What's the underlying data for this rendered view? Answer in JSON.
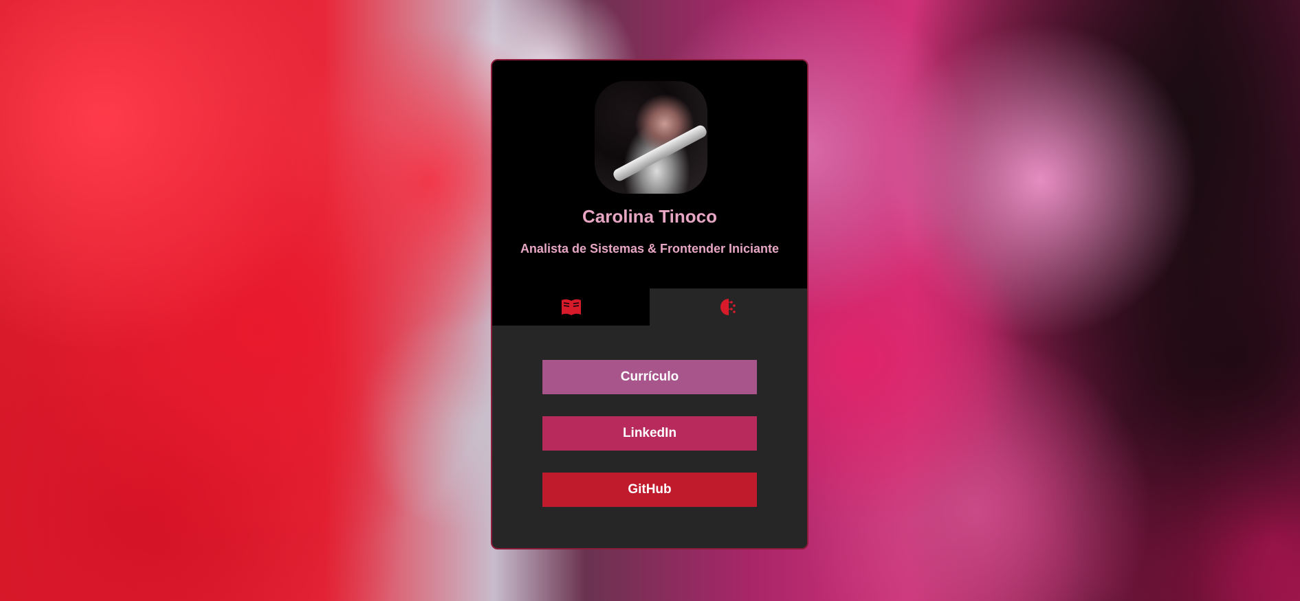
{
  "profile": {
    "name": "Carolina Tinoco",
    "role": "Analista de Sistemas & Frontender Iniciante"
  },
  "tabs": [
    {
      "icon": "book-icon"
    },
    {
      "icon": "brain-icon"
    }
  ],
  "links": [
    {
      "label": "Currículo",
      "color": "#a8558c"
    },
    {
      "label": "LinkedIn",
      "color": "#b92a5c"
    },
    {
      "label": "GitHub",
      "color": "#c01b2c"
    }
  ],
  "colors": {
    "accent": "#e7a7c4",
    "icon": "#d81b2b",
    "card_bg": "#262626"
  }
}
